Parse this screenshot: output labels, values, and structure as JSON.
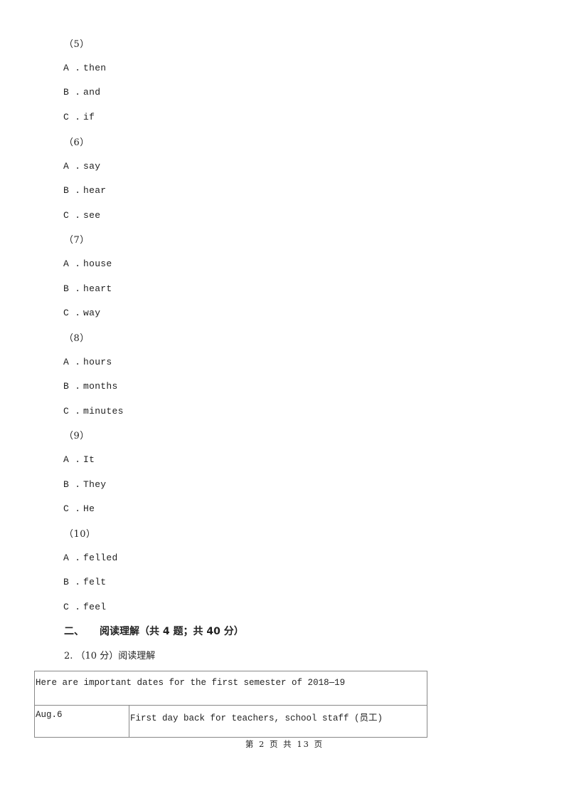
{
  "questions": [
    {
      "number": "（5）",
      "options": [
        {
          "letter": "A .",
          "text": "then"
        },
        {
          "letter": "B .",
          "text": "and"
        },
        {
          "letter": "C .",
          "text": "if"
        }
      ]
    },
    {
      "number": "（6）",
      "options": [
        {
          "letter": "A .",
          "text": "say"
        },
        {
          "letter": "B .",
          "text": "hear"
        },
        {
          "letter": "C .",
          "text": "see"
        }
      ]
    },
    {
      "number": "（7）",
      "options": [
        {
          "letter": "A .",
          "text": "house"
        },
        {
          "letter": "B .",
          "text": "heart"
        },
        {
          "letter": "C .",
          "text": "way"
        }
      ]
    },
    {
      "number": "（8）",
      "options": [
        {
          "letter": "A .",
          "text": "hours"
        },
        {
          "letter": "B .",
          "text": "months"
        },
        {
          "letter": "C .",
          "text": "minutes"
        }
      ]
    },
    {
      "number": "（9）",
      "options": [
        {
          "letter": "A .",
          "text": "It"
        },
        {
          "letter": "B .",
          "text": "They"
        },
        {
          "letter": "C .",
          "text": "He"
        }
      ]
    },
    {
      "number": "（10）",
      "options": [
        {
          "letter": "A .",
          "text": "felled"
        },
        {
          "letter": "B .",
          "text": "felt"
        },
        {
          "letter": "C .",
          "text": "feel"
        }
      ]
    }
  ],
  "section": {
    "number": "二、",
    "title": "阅读理解（共 4 题；共 40 分）"
  },
  "question2": {
    "label": "2. （10 分）阅读理解"
  },
  "table": {
    "header": "Here are important dates for the first semester of 2018—19",
    "rows": [
      {
        "date": "Aug.6",
        "event": "First day back for teachers, school staff (员工)"
      }
    ]
  },
  "footer": {
    "page": "第 2 页 共 13 页"
  }
}
